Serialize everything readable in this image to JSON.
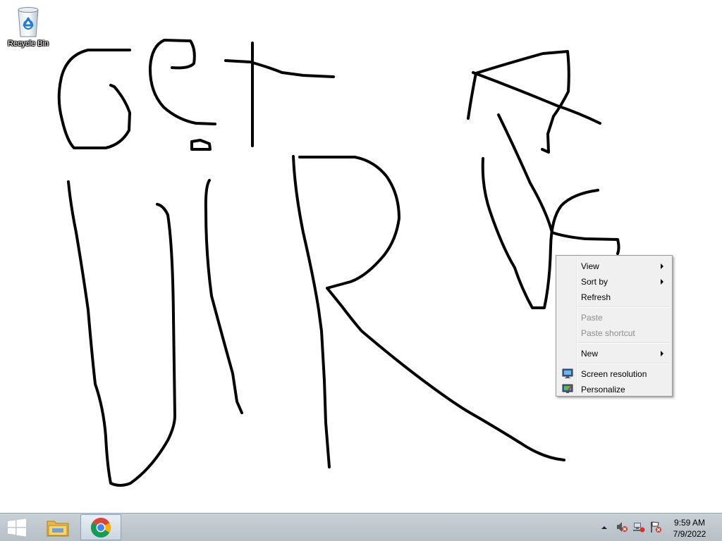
{
  "desktop": {
    "icons": [
      {
        "label": "Recycle Bin",
        "icon": "recycle-bin-icon"
      }
    ]
  },
  "context_menu": {
    "items": [
      {
        "label": "View",
        "submenu": true,
        "enabled": true
      },
      {
        "label": "Sort by",
        "submenu": true,
        "enabled": true
      },
      {
        "label": "Refresh",
        "submenu": false,
        "enabled": true
      },
      {
        "label": "Paste",
        "submenu": false,
        "enabled": false
      },
      {
        "label": "Paste shortcut",
        "submenu": false,
        "enabled": false
      },
      {
        "label": "New",
        "submenu": true,
        "enabled": true
      },
      {
        "label": "Screen resolution",
        "submenu": false,
        "enabled": true,
        "icon": "display-icon"
      },
      {
        "label": "Personalize",
        "submenu": false,
        "enabled": true,
        "icon": "personalize-icon"
      }
    ]
  },
  "taskbar": {
    "start_icon": "windows-logo-icon",
    "pinned": [
      {
        "name": "File Explorer",
        "icon": "folder-icon"
      },
      {
        "name": "Google Chrome",
        "icon": "chrome-icon",
        "active": true
      }
    ],
    "tray": {
      "icons": [
        "show-hidden-icons-chevron",
        "speaker-muted-icon",
        "network-error-icon",
        "action-center-flag-icon"
      ],
      "time": "9:59 AM",
      "date": "7/9/2022"
    }
  },
  "colors": {
    "desktop_bg": "#ffffff",
    "menu_bg": "#f0f0f0",
    "taskbar_bg": "#bfc7cf",
    "disabled_text": "#8d8d8d"
  }
}
